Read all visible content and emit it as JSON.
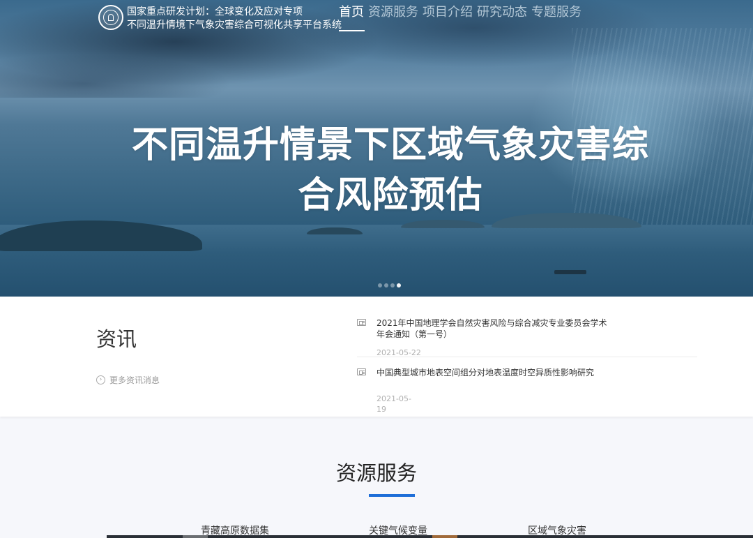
{
  "header": {
    "brand_line1": "国家重点研发计划：全球变化及应对专项",
    "brand_line2": "不同温升情境下气象灾害综合可视化共享平台系统",
    "nav": [
      "首页",
      "资源服务",
      "项目介绍",
      "研究动态",
      "专题服务"
    ],
    "active_nav": "首页"
  },
  "hero": {
    "title_line1": "不同温升情景下区域气象灾害综",
    "title_line2": "合风险预估",
    "carousel_slides": 4,
    "active_slide": 4
  },
  "news": {
    "heading": "资讯",
    "more_label": "更多资讯消息",
    "items": [
      {
        "title": "2021年中国地理学会自然灾害风险与综合减灾专业委员会学术年会通知（第一号）",
        "date": "2021-05-22"
      },
      {
        "title": "中国典型城市地表空间组分对地表温度时空异质性影响研究",
        "date": "2021-05-19"
      }
    ]
  },
  "resources": {
    "heading": "资源服务",
    "items": [
      "青藏高原数据集",
      "关键气候变量",
      "区域气象灾害"
    ]
  },
  "colors": {
    "accent": "#1e6ed8",
    "hero_sky": "#3f6b89"
  }
}
